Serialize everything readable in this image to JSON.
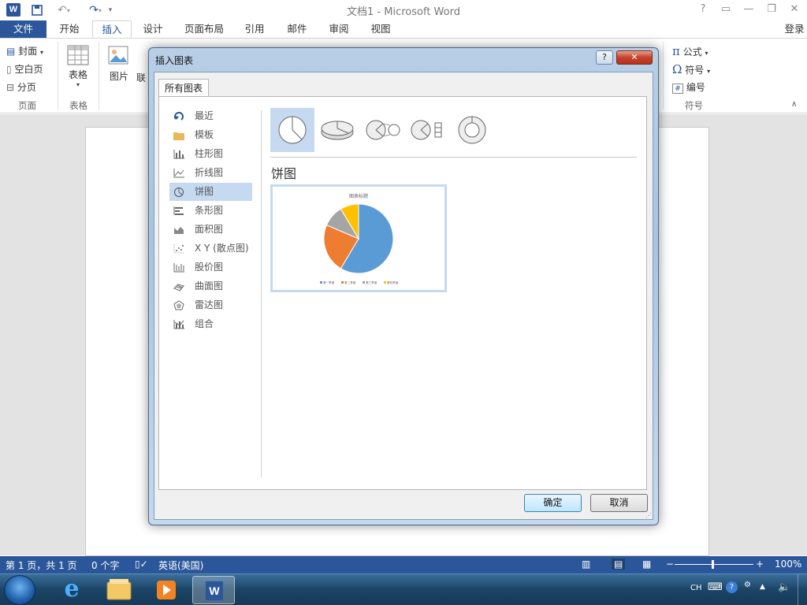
{
  "window": {
    "title": "文档1 - Microsoft Word",
    "help": "?",
    "login": "登录"
  },
  "ribbon_tabs": [
    "文件",
    "开始",
    "插入",
    "设计",
    "页面布局",
    "引用",
    "邮件",
    "审阅",
    "视图"
  ],
  "ribbon": {
    "pages_group": {
      "cover": "封面",
      "blank": "空白页",
      "break": "分页",
      "label": "页面"
    },
    "tables_group": {
      "table": "表格",
      "label": "表格"
    },
    "pictures": "图片",
    "online_partial": "联",
    "symbols_group": {
      "equation": "公式",
      "symbol": "符号",
      "number": "编号",
      "label": "符号"
    }
  },
  "dialog": {
    "title": "插入图表",
    "tab": "所有图表",
    "categories": [
      "最近",
      "模板",
      "柱形图",
      "折线图",
      "饼图",
      "条形图",
      "面积图",
      "X Y (散点图)",
      "股价图",
      "曲面图",
      "雷达图",
      "组合"
    ],
    "selected_category": "饼图",
    "chart_title": "饼图",
    "preview_title": "图表标题",
    "ok": "确定",
    "cancel": "取消"
  },
  "chart_data": {
    "type": "pie",
    "title": "图表标题",
    "categories": [
      "第一季度",
      "第二季度",
      "第三季度",
      "第四季度"
    ],
    "values": [
      8.2,
      3.2,
      1.4,
      1.2
    ],
    "colors": [
      "#5b9bd5",
      "#ed7d31",
      "#a5a5a5",
      "#ffc000"
    ]
  },
  "status": {
    "page": "第 1 页，共 1 页",
    "words": "0 个字",
    "lang": "英语(美国)",
    "zoom": "100%"
  },
  "tray": {
    "lang": "CH"
  }
}
